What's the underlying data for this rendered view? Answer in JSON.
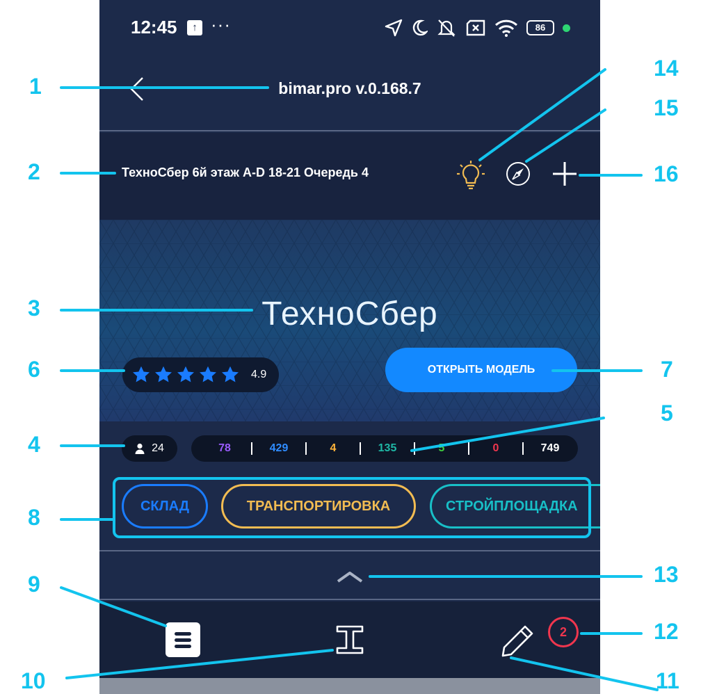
{
  "status_bar": {
    "time": "12:45",
    "dots": "···",
    "battery": "86",
    "icons": [
      "location-icon",
      "moon-icon",
      "bell-off-icon",
      "sim-off-icon",
      "wifi-icon",
      "battery-icon"
    ]
  },
  "header": {
    "title": "bimar.pro v.0.168.7"
  },
  "project": {
    "name": "ТехноСбер 6й этаж A-D 18-21 Очередь 4"
  },
  "hero": {
    "title": "ТехноСбер",
    "rating": "4.9",
    "stars": 5,
    "open_model_label": "ОТКРЫТЬ МОДЕЛЬ"
  },
  "stats": {
    "users": "24",
    "values": [
      {
        "value": "78",
        "color": "#9b5cff"
      },
      {
        "value": "429",
        "color": "#2f8cff"
      },
      {
        "value": "4",
        "color": "#ffb43a"
      },
      {
        "value": "135",
        "color": "#1fb8a6"
      },
      {
        "value": "5",
        "color": "#3fcf3f"
      },
      {
        "value": "0",
        "color": "#f0364e"
      },
      {
        "value": "749",
        "color": "#ffffff"
      }
    ]
  },
  "categories": [
    {
      "label": "СКЛАД",
      "color": "#1a7cff"
    },
    {
      "label": "ТРАНСПОРТИРОВКА",
      "color": "#f2bc52"
    },
    {
      "label": "СТРОЙПЛОЩАДКА",
      "color": "#18bfc7"
    }
  ],
  "toolbar": {
    "badge_count": "2"
  },
  "colors": {
    "background": "#1c2a4a",
    "accent": "#1389ff",
    "annotation": "#13c4ee"
  },
  "callouts": [
    "1",
    "2",
    "3",
    "4",
    "5",
    "6",
    "7",
    "8",
    "9",
    "10",
    "11",
    "12",
    "13",
    "14",
    "15",
    "16"
  ]
}
